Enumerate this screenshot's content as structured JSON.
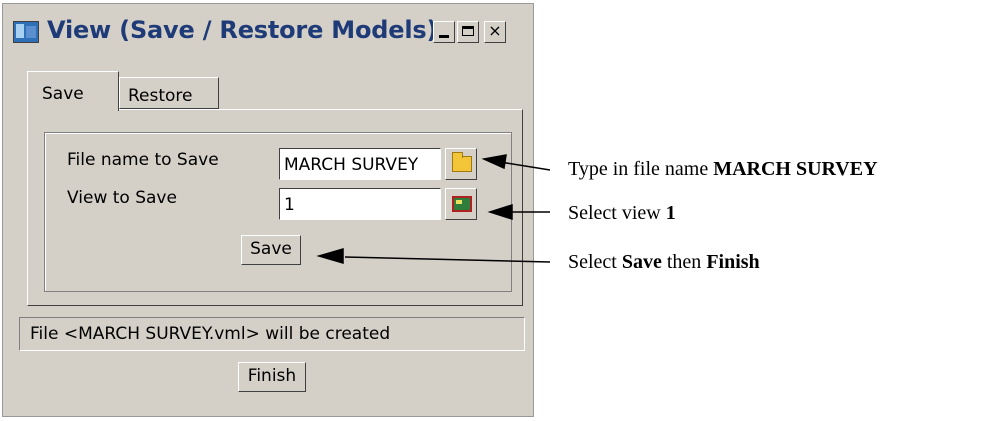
{
  "window": {
    "title": "View (Save / Restore Models)",
    "controls": {
      "minimize": "minimize",
      "maximize": "maximize",
      "close": "×"
    }
  },
  "tabs": [
    {
      "label": "Save",
      "selected": true
    },
    {
      "label": "Restore",
      "selected": false
    }
  ],
  "form": {
    "file_name_label": "File name to Save",
    "file_name_value": "MARCH SURVEY",
    "view_label": "View to Save",
    "view_value": "1",
    "save_button": "Save"
  },
  "status_text": "File <MARCH SURVEY.vml> will be created",
  "finish_button": "Finish",
  "annotations": [
    {
      "prefix": "Type in file name ",
      "bold": "MARCH SURVEY",
      "middle": "",
      "bold2": ""
    },
    {
      "prefix": "Select view ",
      "bold": "1",
      "middle": "",
      "bold2": ""
    },
    {
      "prefix": "Select ",
      "bold": "Save",
      "middle": " then ",
      "bold2": "Finish"
    }
  ],
  "icons": {
    "app": "app-window-icon",
    "file_browse": "folder-icon",
    "view_pick": "view-pick-icon"
  }
}
